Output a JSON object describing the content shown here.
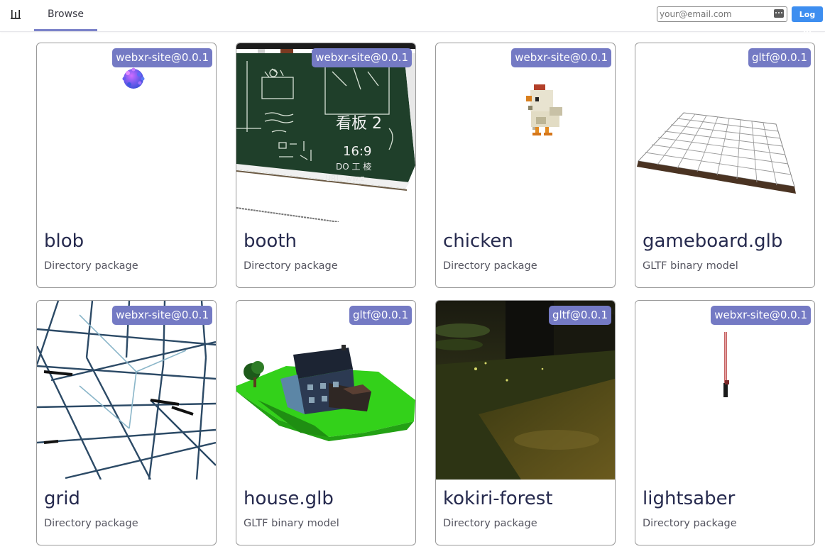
{
  "nav": {
    "tabs": [
      {
        "label": "Browse",
        "active": true
      }
    ]
  },
  "auth": {
    "email_placeholder": "your@email.com",
    "email_value": "",
    "login_label": "Log in"
  },
  "colors": {
    "accent": "#7b82c9",
    "badge": "#747ac4",
    "login_button": "#3d8ef0",
    "title": "#262a4e"
  },
  "packages": [
    {
      "title": "blob",
      "subtitle": "Directory package",
      "badge": "webxr-site@0.0.1",
      "thumbnail": "purple-blob-icon"
    },
    {
      "title": "booth",
      "subtitle": "Directory package",
      "badge": "webxr-site@0.0.1",
      "thumbnail": "chalkboard-booth-render"
    },
    {
      "title": "chicken",
      "subtitle": "Directory package",
      "badge": "webxr-site@0.0.1",
      "thumbnail": "voxel-chicken-render"
    },
    {
      "title": "gameboard.glb",
      "subtitle": "GLTF binary model",
      "badge": "gltf@0.0.1",
      "thumbnail": "grid-gameboard-render"
    },
    {
      "title": "grid",
      "subtitle": "Directory package",
      "badge": "webxr-site@0.0.1",
      "thumbnail": "wireframe-grid-render"
    },
    {
      "title": "house.glb",
      "subtitle": "GLTF binary model",
      "badge": "gltf@0.0.1",
      "thumbnail": "house-island-render"
    },
    {
      "title": "kokiri-forest",
      "subtitle": "Directory package",
      "badge": "gltf@0.0.1",
      "thumbnail": "dark-forest-render"
    },
    {
      "title": "lightsaber",
      "subtitle": "Directory package",
      "badge": "webxr-site@0.0.1",
      "thumbnail": "lightsaber-render"
    }
  ]
}
